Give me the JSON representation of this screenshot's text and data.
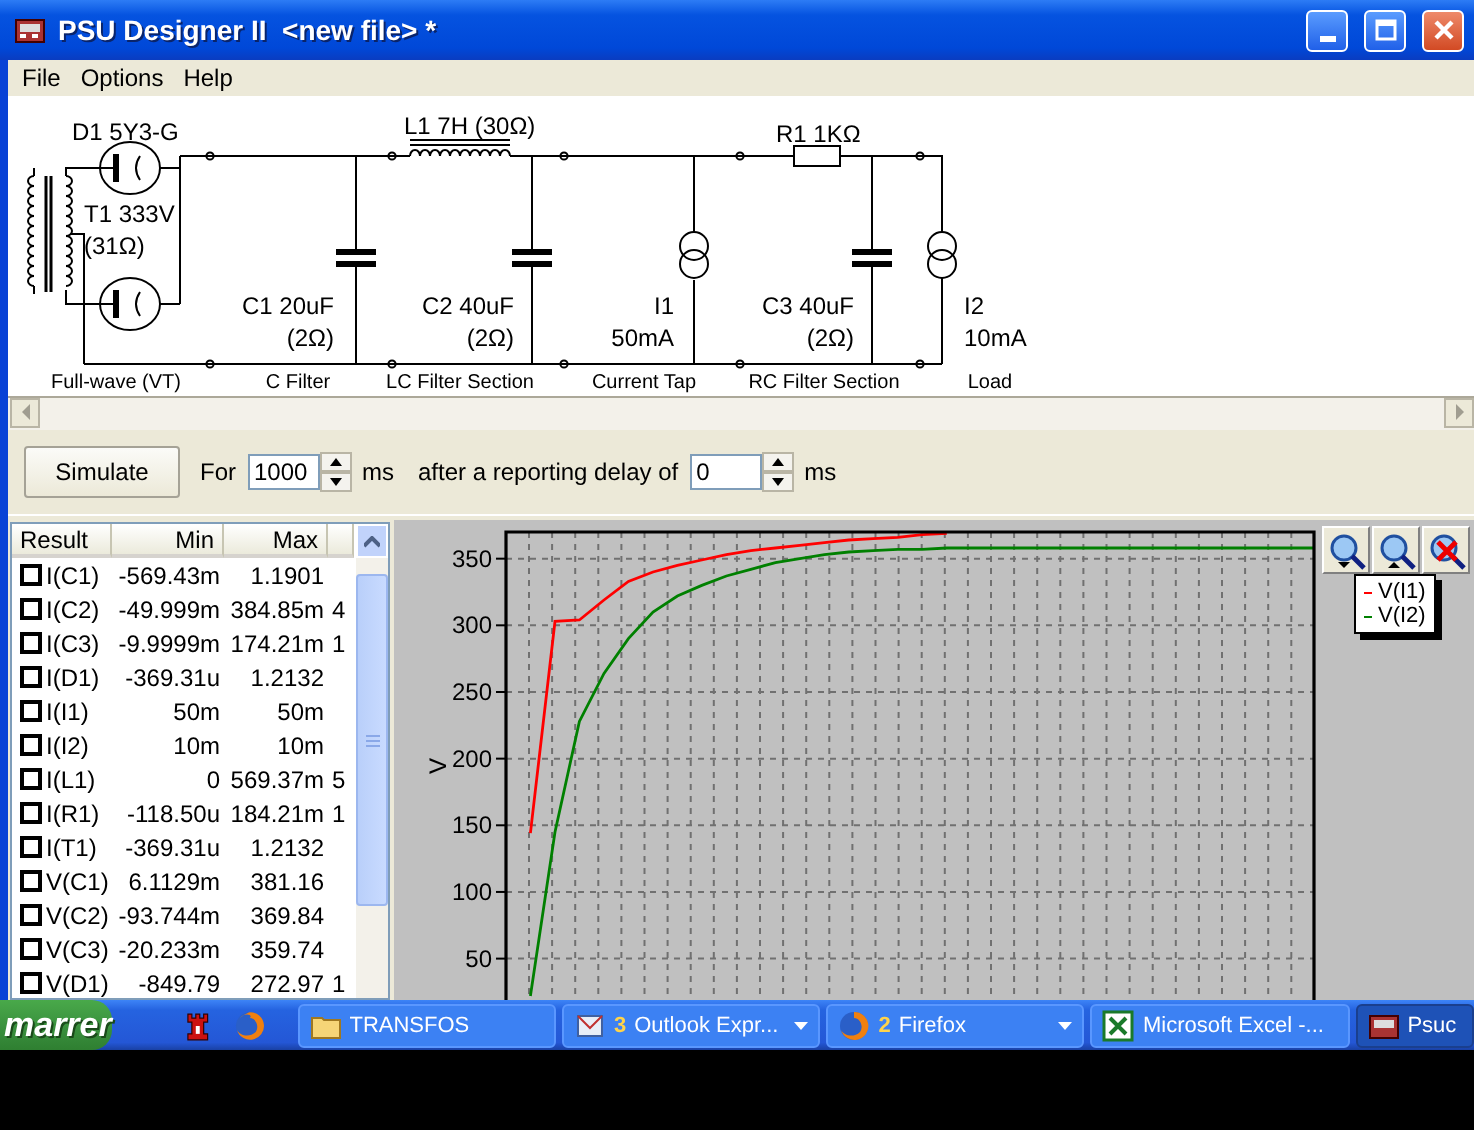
{
  "window": {
    "title": "PSU Designer II  <new file> *"
  },
  "menu": [
    {
      "label": "File"
    },
    {
      "label": "Options"
    },
    {
      "label": "Help"
    }
  ],
  "schematic": {
    "components": [
      {
        "lines": [
          "D1 5Y3-G"
        ]
      },
      {
        "lines": [
          "T1 333V",
          "(31Ω)"
        ]
      },
      {
        "lines": [
          "L1 7H (30Ω)"
        ]
      },
      {
        "lines": [
          "R1 1KΩ"
        ]
      },
      {
        "lines": [
          "C1 20uF",
          "(2Ω)"
        ]
      },
      {
        "lines": [
          "C2 40uF",
          "(2Ω)"
        ]
      },
      {
        "lines": [
          "I1",
          "50mA"
        ]
      },
      {
        "lines": [
          "C3 40uF",
          "(2Ω)"
        ]
      },
      {
        "lines": [
          "I2",
          "10mA"
        ]
      }
    ],
    "sections": [
      "Full-wave (VT)",
      "C Filter",
      "LC Filter Section",
      "Current Tap",
      "RC Filter Section",
      "Load"
    ]
  },
  "simulation": {
    "button": "Simulate",
    "for_label": "For",
    "duration": "1000",
    "duration_unit": "ms",
    "delay_label": "after a reporting delay of",
    "delay": "0",
    "delay_unit": "ms"
  },
  "results": {
    "columns": [
      "Result",
      "Min",
      "Max"
    ],
    "rows": [
      {
        "name": "I(C1)",
        "checked": false,
        "min": "-569.43m",
        "max": "1.1901"
      },
      {
        "name": "I(C2)",
        "checked": false,
        "min": "-49.999m",
        "max": "384.85m",
        "column_4": "4"
      },
      {
        "name": "I(C3)",
        "checked": false,
        "min": "-9.9999m",
        "max": "174.21m",
        "column_4": "1"
      },
      {
        "name": "I(D1)",
        "checked": false,
        "min": "-369.31u",
        "max": "1.2132"
      },
      {
        "name": "I(I1)",
        "checked": false,
        "min": "50m",
        "max": "50m"
      },
      {
        "name": "I(I2)",
        "checked": false,
        "min": "10m",
        "max": "10m"
      },
      {
        "name": "I(L1)",
        "checked": false,
        "min": "0",
        "max": "569.37m",
        "column_4": "5"
      },
      {
        "name": "I(R1)",
        "checked": false,
        "min": "-118.50u",
        "max": "184.21m",
        "column_4": "1"
      },
      {
        "name": "I(T1)",
        "checked": false,
        "min": "-369.31u",
        "max": "1.2132"
      },
      {
        "name": "V(C1)",
        "checked": false,
        "min": "6.1129m",
        "max": "381.16"
      },
      {
        "name": "V(C2)",
        "checked": false,
        "min": "-93.744m",
        "max": "369.84"
      },
      {
        "name": "V(C3)",
        "checked": false,
        "min": "-20.233m",
        "max": "359.74"
      },
      {
        "name": "V(D1)",
        "checked": false,
        "min": "-849.79",
        "max": "272.97",
        "column_4": "1"
      }
    ]
  },
  "chart": {
    "chart_data": {
      "type": "line",
      "ylabel": "V",
      "grid": true,
      "ylim": [
        20,
        370
      ],
      "yticks": [
        50,
        100,
        150,
        200,
        250,
        300,
        350
      ],
      "categories": [
        null,
        null,
        null,
        null,
        null,
        null,
        null,
        null,
        null,
        null,
        null,
        null,
        null,
        null,
        null,
        null,
        null,
        null,
        null,
        null,
        null,
        null,
        null,
        null,
        null,
        null,
        null,
        null,
        null,
        null,
        null,
        null,
        null,
        null
      ],
      "series": [
        {
          "name": "V(I1)",
          "color": "#ff0000",
          "values": [
            null,
            144,
            303,
            304,
            319,
            333,
            340,
            345,
            349,
            353,
            356,
            358,
            360,
            362,
            364,
            365,
            366,
            368,
            369,
            null,
            null,
            null,
            null,
            null,
            null,
            null,
            null,
            null,
            null,
            null,
            null,
            null,
            null,
            null
          ]
        },
        {
          "name": "V(I2)",
          "color": "#008000",
          "values": [
            null,
            22,
            145,
            228,
            264,
            290,
            310,
            322,
            330,
            337,
            342,
            347,
            350,
            353,
            355,
            356,
            357,
            357,
            358,
            358,
            358,
            358,
            358,
            358,
            358,
            358,
            358,
            358,
            358,
            358,
            358,
            358,
            358,
            358
          ]
        }
      ]
    }
  },
  "taskbar": {
    "start": "marrer",
    "tasks": [
      {
        "label": "TRANSFOS",
        "grouped": false,
        "selected": false
      },
      {
        "count": "3",
        "label": "Outlook Expr...",
        "grouped": true,
        "selected": false
      },
      {
        "count": "2",
        "label": "Firefox",
        "grouped": true,
        "selected": false
      },
      {
        "label": "Microsoft Excel -...",
        "grouped": false,
        "selected": false
      },
      {
        "label": "Psuc",
        "grouped": false,
        "selected": true
      }
    ]
  }
}
